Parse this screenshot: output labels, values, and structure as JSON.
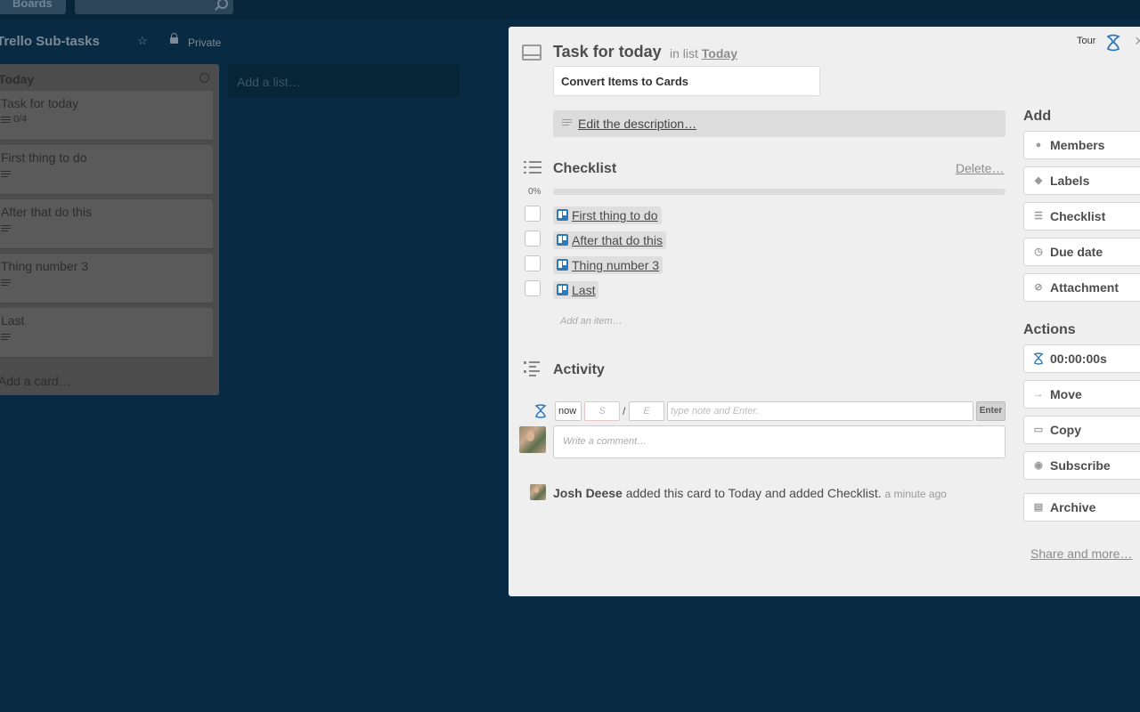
{
  "board": {
    "boards_label": "Boards",
    "title": "Trello Sub-tasks",
    "visibility": "Private",
    "add_list": "Add a list…"
  },
  "list": {
    "title": "Today",
    "cards": [
      {
        "title": "Task for today",
        "badge": "0/4"
      },
      {
        "title": "First thing to do"
      },
      {
        "title": "After that do this"
      },
      {
        "title": "Thing number 3"
      },
      {
        "title": "Last"
      }
    ],
    "add_card": "Add a card…"
  },
  "modal": {
    "title": "Task for today",
    "in_list_prefix": "in list",
    "in_list_name": "Today",
    "tour": "Tour",
    "convert_button": "Convert Items to Cards",
    "description_link": "Edit the description…",
    "checklist": {
      "title": "Checklist",
      "delete": "Delete…",
      "percent": "0%",
      "progress_fraction": 0,
      "items": [
        "First thing to do",
        "After that do this",
        "Thing number 3",
        "Last"
      ],
      "add_item": "Add an item…"
    },
    "activity": {
      "title": "Activity",
      "time_now": "now",
      "start_placeholder": "S",
      "slash": "/",
      "end_placeholder": "E",
      "note_placeholder": "type note and Enter.",
      "enter_button": "Enter",
      "comment_placeholder": "Write a comment…",
      "entry_user": "Josh Deese",
      "entry_text": "added this card to Today and added Checklist.",
      "entry_time": "a minute ago"
    },
    "sidebar": {
      "add_heading": "Add",
      "add_buttons": [
        "Members",
        "Labels",
        "Checklist",
        "Due date",
        "Attachment"
      ],
      "actions_heading": "Actions",
      "timer": "00:00:00s",
      "action_buttons": [
        "Move",
        "Copy",
        "Subscribe"
      ],
      "archive": "Archive",
      "share": "Share and more…"
    }
  },
  "colors": {
    "background": "#082b43",
    "modal": "#efefef",
    "trello_blue": "#2e79bb"
  }
}
